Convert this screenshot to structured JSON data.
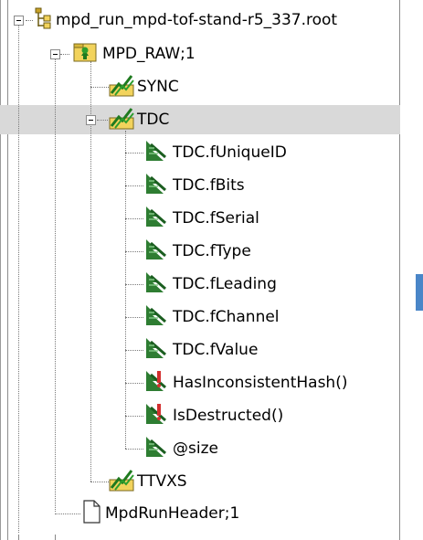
{
  "colors": {
    "selection": "#d9d9d9",
    "leaf": "#2e7d32",
    "folder": "#f2d35c",
    "accent": "#4a86c8",
    "method_marker": "#d32f2f"
  },
  "tree": {
    "root": {
      "label": "mpd_run_mpd-tof-stand-r5_337.root",
      "icon": "root-file-icon"
    },
    "raw": {
      "label": "MPD_RAW;1",
      "icon": "tree-folder-icon"
    },
    "sync": {
      "label": "SYNC",
      "icon": "branch-icon"
    },
    "tdc": {
      "label": "TDC",
      "icon": "branch-icon",
      "selected": true
    },
    "leaves": [
      {
        "label": "TDC.fUniqueID",
        "icon": "leaf-icon"
      },
      {
        "label": "TDC.fBits",
        "icon": "leaf-icon"
      },
      {
        "label": "TDC.fSerial",
        "icon": "leaf-icon"
      },
      {
        "label": "TDC.fType",
        "icon": "leaf-icon"
      },
      {
        "label": "TDC.fLeading",
        "icon": "leaf-icon"
      },
      {
        "label": "TDC.fChannel",
        "icon": "leaf-icon"
      },
      {
        "label": "TDC.fValue",
        "icon": "leaf-icon"
      },
      {
        "label": "HasInconsistentHash()",
        "icon": "leaf-method-icon"
      },
      {
        "label": "IsDestructed()",
        "icon": "leaf-method-icon"
      },
      {
        "label": "@size",
        "icon": "leaf-icon"
      }
    ],
    "ttvxs": {
      "label": "TTVXS",
      "icon": "branch-icon"
    },
    "header": {
      "label": "MpdRunHeader;1",
      "icon": "document-icon"
    }
  }
}
